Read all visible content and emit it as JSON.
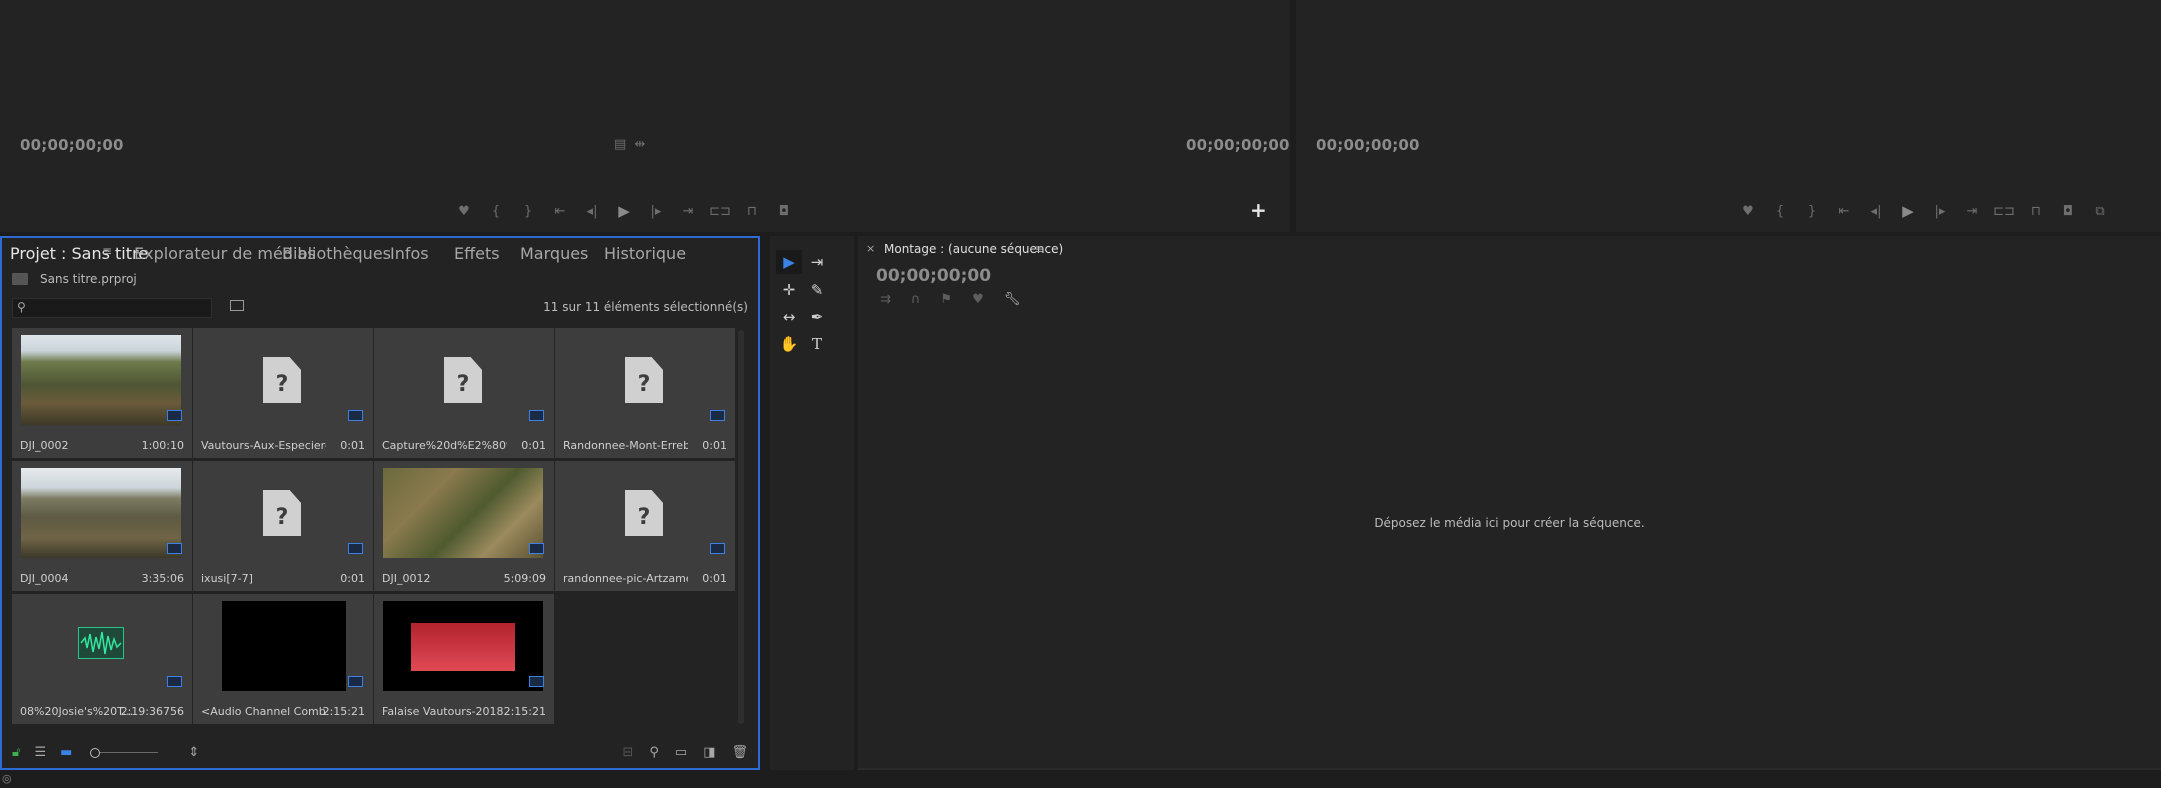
{
  "source_monitor": {
    "timecode_left": "00;00;00;00",
    "timecode_right": "00;00;00;00",
    "add_button": "+"
  },
  "program_monitor": {
    "timecode_left": "00;00;00;00"
  },
  "project_panel": {
    "tabs": [
      "Projet : Sans titre",
      "Explorateur de médias",
      "Bibliothèques",
      "Infos",
      "Effets",
      "Marques",
      "Historique"
    ],
    "project_file": "Sans titre.prproj",
    "search_placeholder": "",
    "selection_count": "11 sur 11 éléments sélectionné(s)",
    "items": [
      {
        "name": "DJI_0002",
        "duration": "1:00:10",
        "thumb": "landscape"
      },
      {
        "name": "Vautours-Aux-Especieres_...",
        "duration": "0:01",
        "thumb": "missing"
      },
      {
        "name": "Capture%20d%E2%80%...",
        "duration": "0:01",
        "thumb": "missing"
      },
      {
        "name": "Randonnee-Mont-Errebi-...",
        "duration": "0:01",
        "thumb": "missing"
      },
      {
        "name": "DJI_0004",
        "duration": "3:35:06",
        "thumb": "landscape2"
      },
      {
        "name": "ixusi[7-7]",
        "duration": "0:01",
        "thumb": "missing"
      },
      {
        "name": "DJI_0012",
        "duration": "5:09:09",
        "thumb": "trail"
      },
      {
        "name": "randonnee-pic-Artzamend...",
        "duration": "0:01",
        "thumb": "missing"
      },
      {
        "name": "08%20Josie's%20T...",
        "duration": "2:19:36756",
        "thumb": "audio"
      },
      {
        "name": "<Audio Channel Comb...",
        "duration": "2:15:21",
        "thumb": "black"
      },
      {
        "name": "Falaise Vautours-2018...",
        "duration": "2:15:21",
        "thumb": "red"
      }
    ]
  },
  "timeline_panel": {
    "title": "Montage : (aucune séquence)",
    "timecode": "00;00;00;00",
    "drop_hint": "Déposez le média ici pour créer la séquence."
  },
  "tools": [
    {
      "name": "selection-tool",
      "glyph": "▶"
    },
    {
      "name": "track-select-tool",
      "glyph": "⇥"
    },
    {
      "name": "ripple-edit-tool",
      "glyph": "✛"
    },
    {
      "name": "razor-tool",
      "glyph": "✎"
    },
    {
      "name": "slip-tool",
      "glyph": "↔"
    },
    {
      "name": "pen-tool",
      "glyph": "✒"
    },
    {
      "name": "hand-tool",
      "glyph": "✋"
    },
    {
      "name": "type-tool",
      "glyph": "T"
    }
  ],
  "colors": {
    "accent": "#2d6bd3",
    "panel_bg": "#232323",
    "app_bg": "#1d1d1d",
    "tile_bg": "#3d3d3d"
  }
}
